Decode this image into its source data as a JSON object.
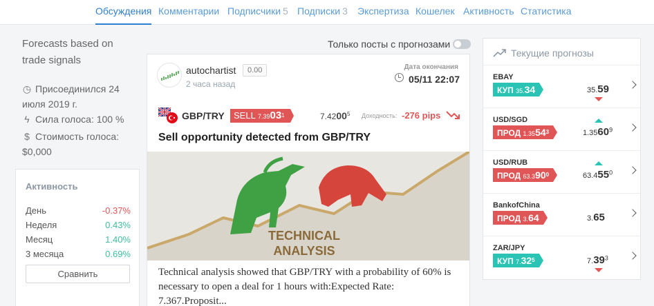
{
  "nav": {
    "tabs": [
      {
        "label": "Обсуждения",
        "count": ""
      },
      {
        "label": "Комментарии",
        "count": ""
      },
      {
        "label": "Подписчики",
        "count": "5"
      },
      {
        "label": "Подписки",
        "count": "3"
      },
      {
        "label": "Экспертиза",
        "count": ""
      },
      {
        "label": "Кошелек",
        "count": ""
      },
      {
        "label": "Активность",
        "count": ""
      },
      {
        "label": "Статистика",
        "count": ""
      }
    ]
  },
  "profile": {
    "bio": "Forecasts based on trade signals",
    "joined": "Присоединился 24 июля 2019 г.",
    "vote_power": "Сила голоса: 100 %",
    "vote_cost": "Стоимость голоса: $0,000"
  },
  "activity": {
    "title": "Активность",
    "rows": [
      {
        "label": "День",
        "value": "-0.37%"
      },
      {
        "label": "Неделя",
        "value": "0.43%"
      },
      {
        "label": "Месяц",
        "value": "1.40%"
      },
      {
        "label": "3 месяца",
        "value": "0.69%"
      }
    ],
    "compare_label": "Сравнить"
  },
  "filter": {
    "label": "Только посты с прогнозами",
    "enabled": false
  },
  "post": {
    "author": "autochartist",
    "reputation": "0.00",
    "posted": "2 часа назад",
    "expiry_label": "Дата окончания",
    "expiry_value": "05/11 22:07",
    "pair": "GBP/TRY",
    "signal": {
      "type": "SELL",
      "price_small": "7.39",
      "price_big": "03",
      "price_sup": "1"
    },
    "current_price": {
      "small": "7.42",
      "big": "00",
      "sup": "5"
    },
    "yield_label": "Доходность:",
    "yield_value": "-276 pips",
    "title": "Sell opportunity detected from GBP/TRY",
    "image_text_1": "TECHNICAL",
    "image_text_2": "ANALYSIS",
    "excerpt": "Technical analysis showed that GBP/TRY with a probability of 60% is necessary to open a deal for 1 hours with:Expected Rate: 7.367.Proposit..."
  },
  "forecasts": {
    "title": "Текущие прогнозы",
    "items": [
      {
        "name": "EBAY",
        "action": "КУП",
        "kind": "buy",
        "chip_small": "35.",
        "chip_big": "34",
        "chip_sup": "",
        "price_small": "35.",
        "price_big": "59",
        "price_sup": "",
        "direction": "down"
      },
      {
        "name": "USD/SGD",
        "action": "ПРОД",
        "kind": "sell",
        "chip_small": "1.35",
        "chip_big": "54",
        "chip_sup": "3",
        "price_small": "1.35",
        "price_big": "60",
        "price_sup": "9",
        "direction": "up"
      },
      {
        "name": "USD/RUB",
        "action": "ПРОД",
        "kind": "sell",
        "chip_small": "63.3",
        "chip_big": "90",
        "chip_sup": "0",
        "price_small": "63.4",
        "price_big": "55",
        "price_sup": "0",
        "direction": "up"
      },
      {
        "name": "BankofChina",
        "action": "ПРОД",
        "kind": "sell",
        "chip_small": "3.",
        "chip_big": "64",
        "chip_sup": "",
        "price_small": "3.",
        "price_big": "65",
        "price_sup": "",
        "direction": "none"
      },
      {
        "name": "ZAR/JPY",
        "action": "КУП",
        "kind": "buy",
        "chip_small": "7.",
        "chip_big": "32",
        "chip_sup": "5",
        "price_small": "7.",
        "price_big": "39",
        "price_sup": "3",
        "direction": "down"
      }
    ]
  },
  "colors": {
    "accent": "#2f7fd0",
    "sell": "#e05656",
    "buy": "#2bc4b4"
  }
}
